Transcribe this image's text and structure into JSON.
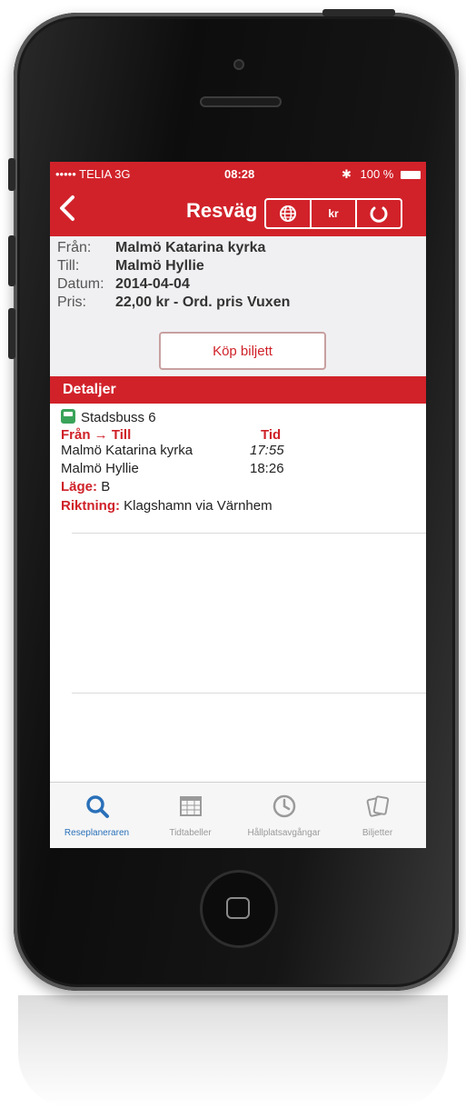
{
  "status_bar": {
    "carrier": "••••• TELIA  3G",
    "time": "08:28",
    "battery": "100 %"
  },
  "nav": {
    "back_icon": "chevron-left-icon",
    "title": "Resväg",
    "buttons": [
      {
        "icon": "globe-icon",
        "label": ""
      },
      {
        "icon": "price-icon",
        "label": "kr"
      },
      {
        "icon": "refresh-icon",
        "label": ""
      }
    ]
  },
  "summary": {
    "from_label": "Från:",
    "from_value": "Malmö Katarina kyrka",
    "to_label": "Till:",
    "to_value": "Malmö Hyllie",
    "date_label": "Datum:",
    "date_value": "2014-04-04",
    "price_label": "Pris:",
    "price_value": "22,00 kr - Ord. pris Vuxen",
    "buy_button": "Köp biljett"
  },
  "details": {
    "header": "Detaljer",
    "line_name": "Stadsbuss 6",
    "col_from_to": "Från → Till",
    "col_time": "Tid",
    "stops": [
      {
        "name": "Malmö Katarina kyrka",
        "time": "17:55"
      },
      {
        "name": "Malmö Hyllie",
        "time": "18:26"
      }
    ],
    "platform_label": "Läge:",
    "platform_value": "B",
    "direction_label": "Riktning:",
    "direction_value": "Klagshamn via Värnhem"
  },
  "tabbar": {
    "tabs": [
      {
        "label": "Reseplaneraren",
        "icon": "search-icon",
        "active": true
      },
      {
        "label": "Tidtabeller",
        "icon": "calendar-icon",
        "active": false
      },
      {
        "label": "Hållplatsavgångar",
        "icon": "clock-icon",
        "active": false
      },
      {
        "label": "Biljetter",
        "icon": "tickets-icon",
        "active": false
      }
    ]
  },
  "colors": {
    "accent": "#d1222a",
    "active_tab": "#2a70b9"
  }
}
